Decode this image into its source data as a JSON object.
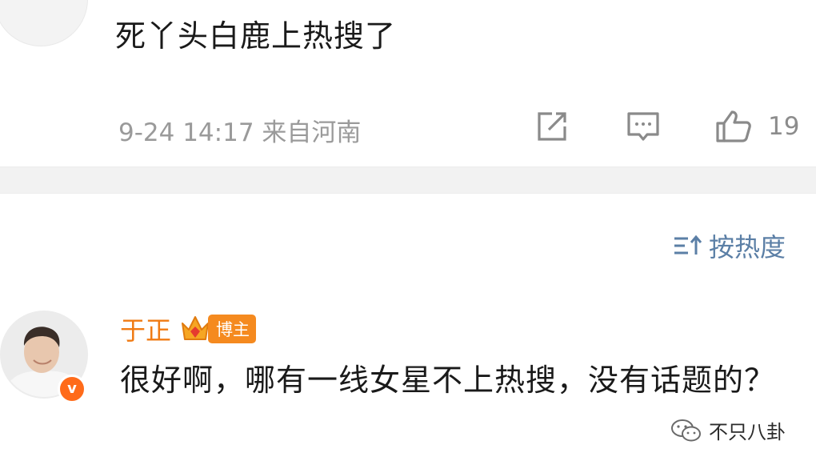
{
  "top_comment": {
    "text": "死丫头白鹿上热搜了",
    "meta": "9-24 14:17 来自河南",
    "like_count": "19",
    "icons": [
      "share-icon",
      "comment-icon",
      "like-icon"
    ]
  },
  "sort": {
    "label": "按热度",
    "icon": "sort-icon"
  },
  "comment2": {
    "author": "于正",
    "badge": "博主",
    "verified_icon": "v",
    "text": "很好啊，哪有一线女星不上热搜，没有话题的？"
  },
  "watermark": {
    "text": "不只八卦",
    "icon": "wechat-icon"
  },
  "colors": {
    "author": "#f07b14",
    "badge": "#f58a1f",
    "sort": "#5b7fa6",
    "meta": "#9a9a9a"
  }
}
